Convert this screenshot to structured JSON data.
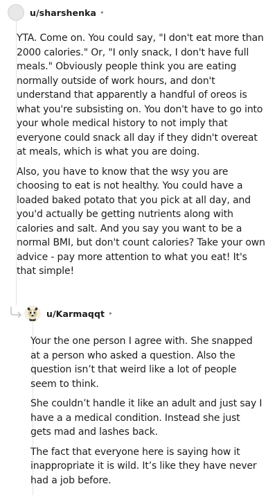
{
  "comment1": {
    "username": "u/sharshenka",
    "separator": "•",
    "paragraphs": [
      "YTA. Come on. You could say, \"I don't eat more than 2000 calories.\" Or, \"I only snack, I don't have full meals.\" Obviously people think you are eating normally outside of work hours, and don't understand that apparently a handful of oreos is what you're subsisting on. You don't have to go into your whole medical history to not imply that everyone could snack all day if they didn't overeat at meals, which is what you are doing.",
      "Also, you have to know that the wsy you are choosing to eat is not healthy. You could have a loaded baked potato that you pick at all day, and you'd actually be getting nutrients along with calories and salt. And you say you want to be a normal BMI, but don't count calories? Take your own advice - pay more attention to what you eat! It's that simple!"
    ]
  },
  "comment2": {
    "username": "u/Karmaqqt",
    "separator": "•",
    "paragraphs": [
      "Your the one person I agree with. She snapped at a person who asked a question. Also the question isn’t that weird like a lot of people seem to think.",
      "She couldn’t handle it like an adult and just say I have a a medical condition. Instead she just gets mad and lashes back.",
      "The fact that everyone here is saying how it inappropriate it is wild. It’s like they have never had a job before."
    ]
  },
  "icons": {
    "avatar1": "avatar-icon",
    "avatar2": "dog-avatar-icon",
    "reply": "reply-arrow-icon"
  },
  "colors": {
    "text": "#1c1c1c",
    "meta": "#7c7c7c",
    "thread_line": "#e4e4e4"
  }
}
